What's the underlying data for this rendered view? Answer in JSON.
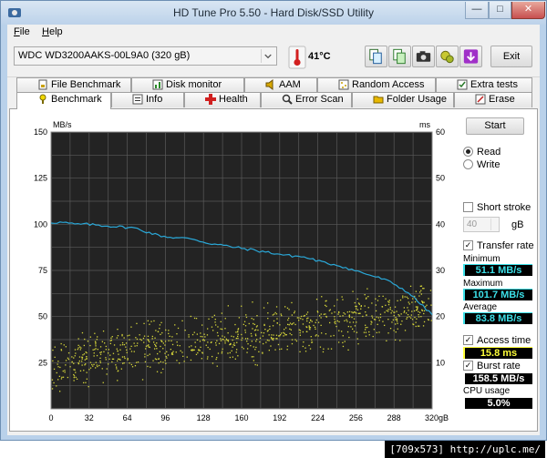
{
  "window": {
    "title": "HD Tune Pro 5.50 - Hard Disk/SSD Utility"
  },
  "menu": {
    "file_label": "File",
    "file_key": "F",
    "file_rest": "ile",
    "help_label": "Help",
    "help_key": "H",
    "help_rest": "elp"
  },
  "toolbar": {
    "drive": "WDC WD3200AAKS-00L9A0 (320 gB)",
    "temperature": "41°C",
    "exit_label": "Exit",
    "icons": [
      "copy-icon",
      "copy-results-icon",
      "camera-icon",
      "options-icon",
      "save-icon"
    ]
  },
  "tabs": {
    "row1": [
      "File Benchmark",
      "Disk monitor",
      "AAM",
      "Random Access",
      "Extra tests"
    ],
    "row2": [
      "Benchmark",
      "Info",
      "Health",
      "Error Scan",
      "Folder Usage",
      "Erase"
    ],
    "active": "Benchmark"
  },
  "side": {
    "start_label": "Start",
    "read_label": "Read",
    "write_label": "Write",
    "short_stroke_label": "Short stroke",
    "short_stroke_value": "40",
    "short_stroke_unit": "gB",
    "transfer_rate_label": "Transfer rate",
    "minimum_label": "Minimum",
    "minimum_value": "51.1 MB/s",
    "maximum_label": "Maximum",
    "maximum_value": "101.7 MB/s",
    "average_label": "Average",
    "average_value": "83.8 MB/s",
    "access_time_label": "Access time",
    "access_time_value": "15.8 ms",
    "burst_rate_label": "Burst rate",
    "burst_rate_value": "158.5 MB/s",
    "cpu_usage_label": "CPU usage",
    "cpu_usage_value": "5.0%"
  },
  "chart_data": {
    "type": "line",
    "left_unit": "MB/s",
    "right_unit": "ms",
    "x_unit": "gB",
    "x_ticks": [
      "0",
      "32",
      "64",
      "96",
      "128",
      "160",
      "192",
      "224",
      "256",
      "288",
      "320"
    ],
    "y_left_ticks": [
      "150",
      "125",
      "100",
      "75",
      "50",
      "25"
    ],
    "y_right_ticks": [
      "60",
      "50",
      "40",
      "30",
      "20",
      "10"
    ],
    "xlim": [
      0,
      320
    ],
    "ylim_left": [
      0,
      150
    ],
    "ylim_right": [
      0,
      60
    ],
    "grid": true,
    "colors": {
      "background": "#232323",
      "grid": "#5a5a5a",
      "transfer": "#2aa8d8",
      "access": "#d6d63a"
    },
    "transfer_rate": {
      "x": [
        0,
        10,
        20,
        30,
        40,
        50,
        60,
        70,
        80,
        90,
        100,
        110,
        120,
        130,
        140,
        150,
        160,
        170,
        180,
        190,
        200,
        210,
        220,
        230,
        240,
        250,
        260,
        270,
        280,
        290,
        300,
        310,
        320
      ],
      "y": [
        101,
        101,
        100,
        100,
        99.5,
        99,
        98.5,
        98,
        96,
        94,
        93,
        92.5,
        92,
        90,
        89,
        88,
        87,
        86,
        85,
        84,
        83,
        82.5,
        81,
        79,
        78,
        76,
        74,
        72,
        70,
        67,
        63,
        57,
        51
      ]
    },
    "access_time": {
      "trend_x": [
        0,
        40,
        80,
        120,
        160,
        200,
        240,
        280,
        320
      ],
      "trend_y": [
        9,
        11.5,
        13,
        14.5,
        16,
        17.5,
        19,
        20.5,
        22
      ],
      "spread": 5,
      "count": 900
    }
  },
  "watermark": "[709x573] http://uplc.me/"
}
